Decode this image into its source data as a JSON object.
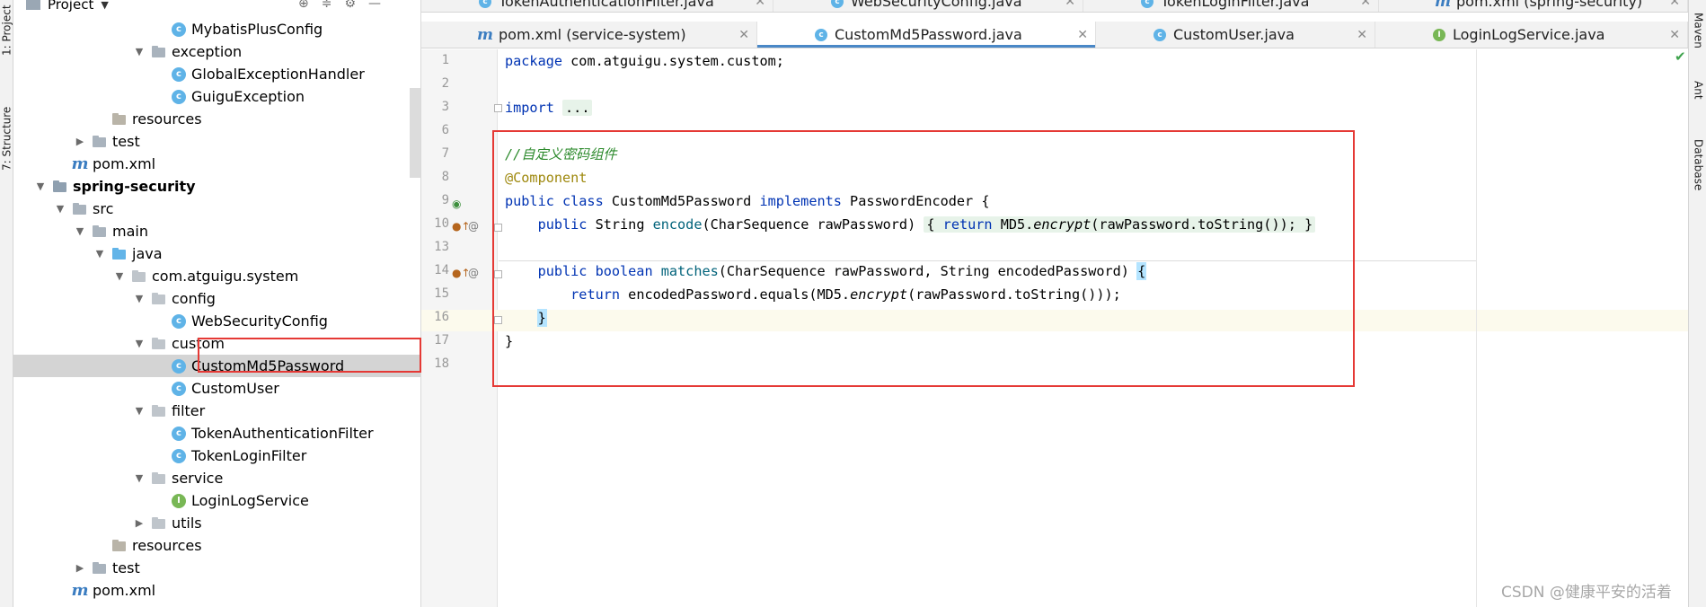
{
  "left_strip": {
    "project_tab": "1: Project",
    "structure_tab": "7: Structure"
  },
  "right_strip": {
    "maven_tab": "Maven",
    "ant_tab": "Ant",
    "database_tab": "Database"
  },
  "project_panel": {
    "title": "Project",
    "tree": [
      {
        "label": "MybatisPlusConfig",
        "icon": "class-icon",
        "depth": 8,
        "caret": ""
      },
      {
        "label": "exception",
        "icon": "folder-icon",
        "depth": 7,
        "caret": "open"
      },
      {
        "label": "GlobalExceptionHandler",
        "icon": "class-icon",
        "depth": 8,
        "caret": ""
      },
      {
        "label": "GuiguException",
        "icon": "class-icon",
        "depth": 8,
        "caret": ""
      },
      {
        "label": "resources",
        "icon": "resources-folder-icon",
        "depth": 5,
        "caret": ""
      },
      {
        "label": "test",
        "icon": "folder-icon",
        "depth": 4,
        "caret": "closed"
      },
      {
        "label": "pom.xml",
        "icon": "maven-icon",
        "depth": 3,
        "caret": ""
      },
      {
        "label": "spring-security",
        "icon": "module-icon",
        "depth": 2,
        "caret": "open",
        "bold": true
      },
      {
        "label": "src",
        "icon": "folder-icon",
        "depth": 3,
        "caret": "open"
      },
      {
        "label": "main",
        "icon": "folder-icon",
        "depth": 4,
        "caret": "open"
      },
      {
        "label": "java",
        "icon": "source-folder-icon",
        "depth": 5,
        "caret": "open"
      },
      {
        "label": "com.atguigu.system",
        "icon": "package-icon",
        "depth": 6,
        "caret": "open"
      },
      {
        "label": "config",
        "icon": "package-icon",
        "depth": 7,
        "caret": "open"
      },
      {
        "label": "WebSecurityConfig",
        "icon": "class-icon",
        "depth": 8,
        "caret": ""
      },
      {
        "label": "custom",
        "icon": "package-icon",
        "depth": 7,
        "caret": "open"
      },
      {
        "label": "CustomMd5Password",
        "icon": "class-icon",
        "depth": 8,
        "caret": "",
        "selected": true
      },
      {
        "label": "CustomUser",
        "icon": "class-icon",
        "depth": 8,
        "caret": ""
      },
      {
        "label": "filter",
        "icon": "package-icon",
        "depth": 7,
        "caret": "open"
      },
      {
        "label": "TokenAuthenticationFilter",
        "icon": "class-icon",
        "depth": 8,
        "caret": ""
      },
      {
        "label": "TokenLoginFilter",
        "icon": "class-icon",
        "depth": 8,
        "caret": ""
      },
      {
        "label": "service",
        "icon": "package-icon",
        "depth": 7,
        "caret": "open"
      },
      {
        "label": "LoginLogService",
        "icon": "interface-icon",
        "depth": 8,
        "caret": ""
      },
      {
        "label": "utils",
        "icon": "package-icon",
        "depth": 7,
        "caret": "closed"
      },
      {
        "label": "resources",
        "icon": "resources-folder-icon",
        "depth": 5,
        "caret": ""
      },
      {
        "label": "test",
        "icon": "folder-icon",
        "depth": 4,
        "caret": "closed"
      },
      {
        "label": "pom.xml",
        "icon": "maven-icon",
        "depth": 3,
        "caret": ""
      }
    ]
  },
  "tabs_top": [
    {
      "label": "TokenAuthenticationFilter.java",
      "icon": "class-icon"
    },
    {
      "label": "WebSecurityConfig.java",
      "icon": "class-icon"
    },
    {
      "label": "TokenLoginFilter.java",
      "icon": "class-icon"
    },
    {
      "label": "pom.xml (spring-security)",
      "icon": "maven-icon"
    }
  ],
  "tabs_main": [
    {
      "label": "pom.xml (service-system)",
      "icon": "maven-icon",
      "active": false
    },
    {
      "label": "CustomMd5Password.java",
      "icon": "class-icon",
      "active": true
    },
    {
      "label": "CustomUser.java",
      "icon": "class-icon",
      "active": false
    },
    {
      "label": "LoginLogService.java",
      "icon": "interface-icon",
      "active": false
    }
  ],
  "editor": {
    "line_numbers": [
      "1",
      "2",
      "3",
      "6",
      "7",
      "8",
      "9",
      "10",
      "13",
      "14",
      "15",
      "16",
      "17",
      "18"
    ],
    "code": {
      "package_kw": "package",
      "package_name": " com.atguigu.system.custom;",
      "import_kw": "import",
      "import_fold": "...",
      "comment": "//自定义密码组件",
      "annotation": "@Component",
      "class_decl_1": "public class",
      "class_name": " CustomMd5Password ",
      "implements_kw": "implements",
      "class_decl_2": " PasswordEncoder {",
      "encode_public": "public",
      "encode_type": " String ",
      "encode_name": "encode",
      "encode_params": "(CharSequence rawPassword) ",
      "encode_body_open": "{ ",
      "encode_return": "return",
      "encode_body": " MD5.",
      "encode_call": "encrypt",
      "encode_args": "(rawPassword.toString()); ",
      "encode_body_close": "}",
      "matches_public": "public boolean",
      "matches_name": "matches",
      "matches_params": "(CharSequence rawPassword, String encodedPassword) ",
      "matches_open": "{",
      "return_kw": "return",
      "return_body": " encodedPassword.equals(MD5.",
      "return_call": "encrypt",
      "return_args": "(rawPassword.toString()));",
      "method_close": "}",
      "class_close": "}"
    }
  },
  "watermark": "CSDN @健康平安的活着",
  "colors": {
    "highlight_box": "#e53935",
    "keyword": "#0033b3",
    "comment": "#2e8b2e",
    "annotation": "#9e880d",
    "tab_underline": "#4a88c7"
  }
}
